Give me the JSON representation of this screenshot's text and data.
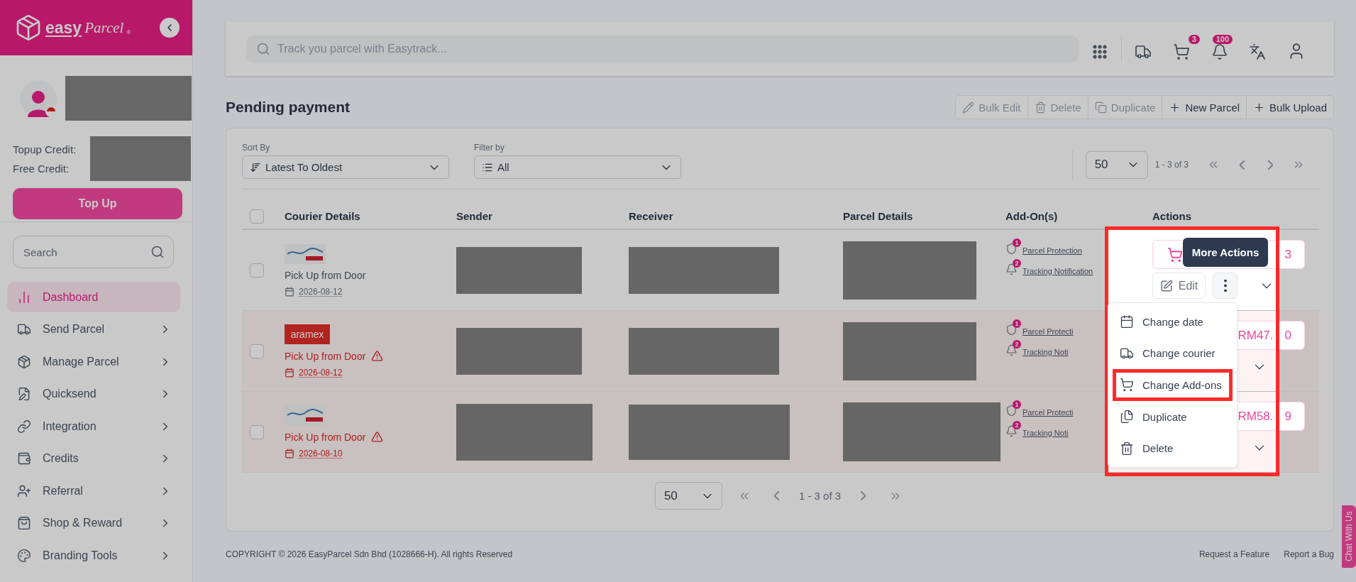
{
  "sidebar": {
    "logo": {
      "brand_main": "easy",
      "brand_script": "Parcel",
      "mark": "®"
    },
    "profile": {
      "name": {
        "kind": "redacted"
      }
    },
    "credits": [
      {
        "label": "Topup Credit:"
      },
      {
        "label": "Free Credit:"
      }
    ],
    "credit_values": {
      "kind": "redacted"
    },
    "top_up_button": "Top Up",
    "search": {
      "placeholder": "Search"
    },
    "nav": [
      {
        "label": "Dashboard",
        "selected": true,
        "expandable": false
      },
      {
        "label": "Send Parcel",
        "selected": false,
        "expandable": true
      },
      {
        "label": "Manage Parcel",
        "selected": false,
        "expandable": true
      },
      {
        "label": "Quicksend",
        "selected": false,
        "expandable": true
      },
      {
        "label": "Integration",
        "selected": false,
        "expandable": true
      },
      {
        "label": "Credits",
        "selected": false,
        "expandable": true
      },
      {
        "label": "Referral",
        "selected": false,
        "expandable": true
      },
      {
        "label": "Shop & Reward",
        "selected": false,
        "expandable": true
      },
      {
        "label": "Branding Tools",
        "selected": false,
        "expandable": true
      }
    ]
  },
  "topbar": {
    "search_placeholder": "Track you parcel with Easytrack...",
    "cart_badge": "3",
    "notification_badge": "100"
  },
  "page_title": "Pending payment",
  "toolbar": [
    {
      "label": "Bulk Edit",
      "disabled": true
    },
    {
      "label": "Delete",
      "disabled": true
    },
    {
      "label": "Duplicate",
      "disabled": true
    },
    {
      "label": "New Parcel",
      "disabled": false
    },
    {
      "label": "Bulk Upload",
      "disabled": false
    }
  ],
  "filters": [
    {
      "label": "Sort By",
      "value": "Latest To Oldest"
    },
    {
      "label": "Filter by",
      "value": "All"
    }
  ],
  "top_pager": {
    "page_size": "50",
    "range": "1 - 3 of 3"
  },
  "table": {
    "all_checked": false,
    "columns": [
      "Courier Details",
      "Sender",
      "Receiver",
      "Parcel Details",
      "Add-On(s)",
      "Actions"
    ],
    "rows": [
      {
        "checked": false,
        "warning": false,
        "courier": {
          "kind": "singpost"
        },
        "service": "Pick Up from Door",
        "date": "2026-08-12",
        "sender": {
          "kind": "redacted"
        },
        "receiver": {
          "kind": "redacted"
        },
        "parcel_details": {
          "kind": "redacted"
        },
        "addons": [
          {
            "count": "1",
            "label": "Parcel Protection"
          },
          {
            "count": "2",
            "label": "Tracking Notification"
          }
        ],
        "price_end": "3",
        "edit_label": "Edit",
        "menu_open": true
      },
      {
        "checked": false,
        "warning": true,
        "courier": {
          "kind": "aramex",
          "logo_text": "aramex"
        },
        "service": "Pick Up from Door",
        "date": "2026-08-12",
        "sender": {
          "kind": "redacted"
        },
        "receiver": {
          "kind": "redacted"
        },
        "parcel_details": {
          "kind": "redacted"
        },
        "addons": [
          {
            "count": "1",
            "label": "Parcel Protecti"
          },
          {
            "count": "2",
            "label": "Tracking Noti"
          }
        ],
        "price_start": "RM47.",
        "price_end": "0"
      },
      {
        "checked": false,
        "warning": true,
        "courier": {
          "kind": "singpost"
        },
        "service": "Pick Up from Door",
        "date": "2026-08-10",
        "sender": {
          "kind": "redacted"
        },
        "receiver": {
          "kind": "redacted"
        },
        "parcel_details": {
          "kind": "redacted"
        },
        "addons": [
          {
            "count": "1",
            "label": "Parcel Protecti"
          },
          {
            "count": "2",
            "label": "Tracking Noti"
          }
        ],
        "price_start": "RM58.",
        "price_end": "9"
      }
    ]
  },
  "more_actions": {
    "tooltip": "More Actions",
    "items": [
      {
        "label": "Change date",
        "highlighted": false
      },
      {
        "label": "Change courier",
        "highlighted": false
      },
      {
        "label": "Change Add-ons",
        "highlighted": true
      },
      {
        "label": "Duplicate",
        "highlighted": false
      },
      {
        "label": "Delete",
        "highlighted": false
      }
    ]
  },
  "pagination": {
    "page_size": "50",
    "range": "1 - 3 of 3"
  },
  "footer": {
    "copyright": "COPYRIGHT © 2026 EasyParcel Sdn Bhd (1028666-H). All rights Reserved",
    "links": [
      "Request a Feature",
      "Report a Bug"
    ]
  },
  "chat_tab": "Chat With Us",
  "spotlight": true
}
